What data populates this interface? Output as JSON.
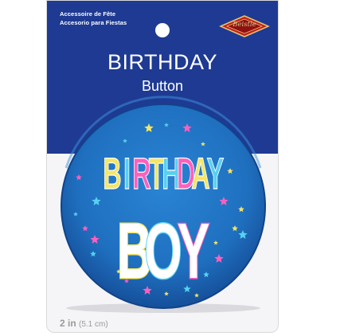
{
  "package": {
    "notes": [
      "Accessoire de Fête",
      "Accesorio para Fiestas"
    ],
    "brand_logo": "Beistle",
    "title": "BIRTHDAY",
    "subtitle": "Button",
    "size": "2 in",
    "size_metric": "(5.1 cm)"
  },
  "button_face": {
    "line_1": "BIRTHDAY",
    "line_2": "BOY",
    "letter_colors": [
      "#f5e663",
      "#58d0ef",
      "#ff5fbd",
      "#f5e663",
      "#58d0ef",
      "#ff5fbd",
      "#f5e663",
      "#58d0ef"
    ],
    "boy_colors": [
      "#f5e663",
      "#58d0ef",
      "#ff5fbd"
    ]
  },
  "colors": {
    "card_blue": "#1e3a93",
    "button_blue": "#1f6fbf",
    "button_blue_dark": "#154f99",
    "star_colors": [
      "#f5e663",
      "#58d0ef",
      "#ff5fbd"
    ]
  },
  "icons": [
    "hang-hole-icon",
    "brand-logo-icon",
    "star-icon"
  ]
}
